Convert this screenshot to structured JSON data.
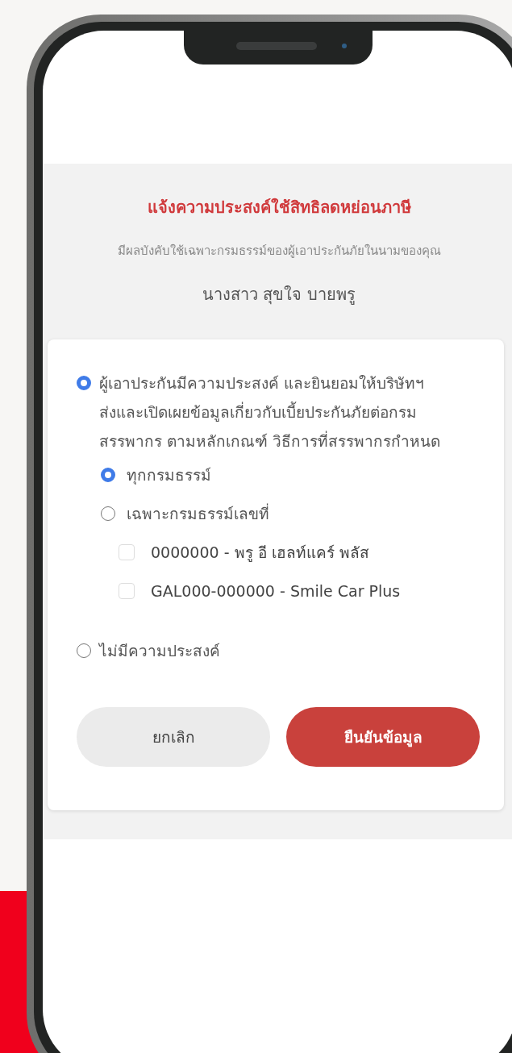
{
  "title": "แจ้งความประสงค์ใช้สิทธิลดหย่อนภาษี",
  "subtitle": "มีผลบังคับใช้เฉพาะกรมธรรม์ของผู้เอาประกันภัยในนามของคุณ",
  "insured_name": "นางสาว สุขใจ บายพรู",
  "options": [
    {
      "kind": "radio",
      "label": "ผู้เอาประกันมีความประสงค์ และยินยอมให้บริษัทฯ ส่งและเปิดเผยข้อมูลเกี่ยวกับเบี้ยประกันภัยต่อกรมสรรพากร ตามหลักเกณฑ์ วิธีการที่สรรพากรกำหนด",
      "selected": true,
      "children": [
        {
          "kind": "radio",
          "label": "ทุกกรมธรรม์",
          "selected": true
        },
        {
          "kind": "radio",
          "label": "เฉพาะกรมธรรม์เลขที่",
          "selected": false,
          "children": [
            {
              "kind": "checkbox",
              "label": "0000000 - พรู อี เฮลท์แคร์ พลัส",
              "checked": false
            },
            {
              "kind": "checkbox",
              "label": "GAL000-000000 - Smile Car Plus",
              "checked": false
            }
          ]
        }
      ]
    },
    {
      "kind": "radio",
      "label": "ไม่มีความประสงค์",
      "selected": false
    }
  ],
  "buttons": [
    {
      "kind": "secondary",
      "label": "ยกเลิก"
    },
    {
      "kind": "primary",
      "label": "ยืนยันข้อมูล"
    }
  ]
}
